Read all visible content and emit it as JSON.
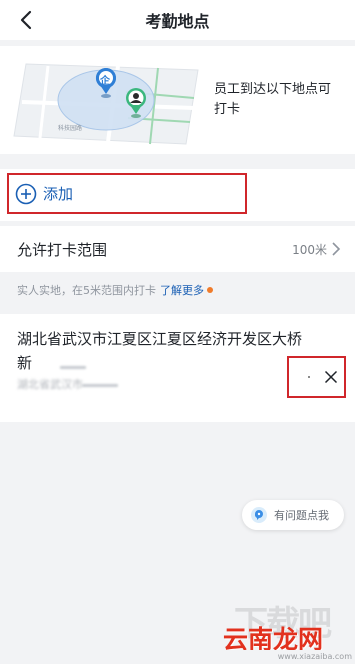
{
  "header": {
    "title": "考勤地点",
    "back_icon": "chevron-left-icon"
  },
  "hero": {
    "description": "员工到达以下地点可打卡",
    "map_pin_label": "企",
    "map_road_label": "科技园路"
  },
  "add": {
    "label": "添加",
    "icon": "plus-circle-icon"
  },
  "range": {
    "label": "允许打卡范围",
    "value": "100米"
  },
  "hint": {
    "text": "实人实地，在5米范围内打卡",
    "link": "了解更多"
  },
  "location": {
    "title": "湖北省武汉市江夏区江夏区经济开发区大桥",
    "line2": "新",
    "subtitle": "湖北省武汉市",
    "delete_icon": "close-icon"
  },
  "help": {
    "label": "有问题点我"
  },
  "watermark": {
    "big": "下载吧",
    "brand": "云南龙网",
    "url": "www.xiazaiba.com"
  },
  "colors": {
    "accent_blue": "#1a5fb4",
    "highlight_red": "#d0262b",
    "badge_orange": "#f07b2a"
  }
}
